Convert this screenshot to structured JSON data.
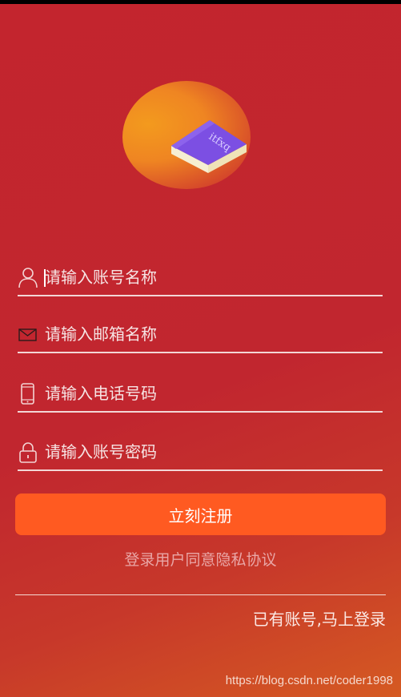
{
  "logo": {
    "text": "itfxq"
  },
  "form": {
    "account_placeholder": "请输入账号名称",
    "email_placeholder": "请输入邮箱名称",
    "phone_placeholder": "请输入电话号码",
    "password_placeholder": "请输入账号密码",
    "account_value": "",
    "email_value": "",
    "phone_value": "",
    "password_value": ""
  },
  "actions": {
    "register_label": "立刻注册",
    "agreement_link": "登录用户同意隐私协议",
    "login_link": "已有账号,马上登录"
  },
  "watermark": "https://blog.csdn.net/coder1998",
  "colors": {
    "background": "#c1262f",
    "button": "#ff5a21",
    "logo_book": "#7b4fe0",
    "logo_blob": "#f08a20"
  },
  "icons": [
    "user-icon",
    "mail-icon",
    "phone-icon",
    "lock-icon"
  ]
}
